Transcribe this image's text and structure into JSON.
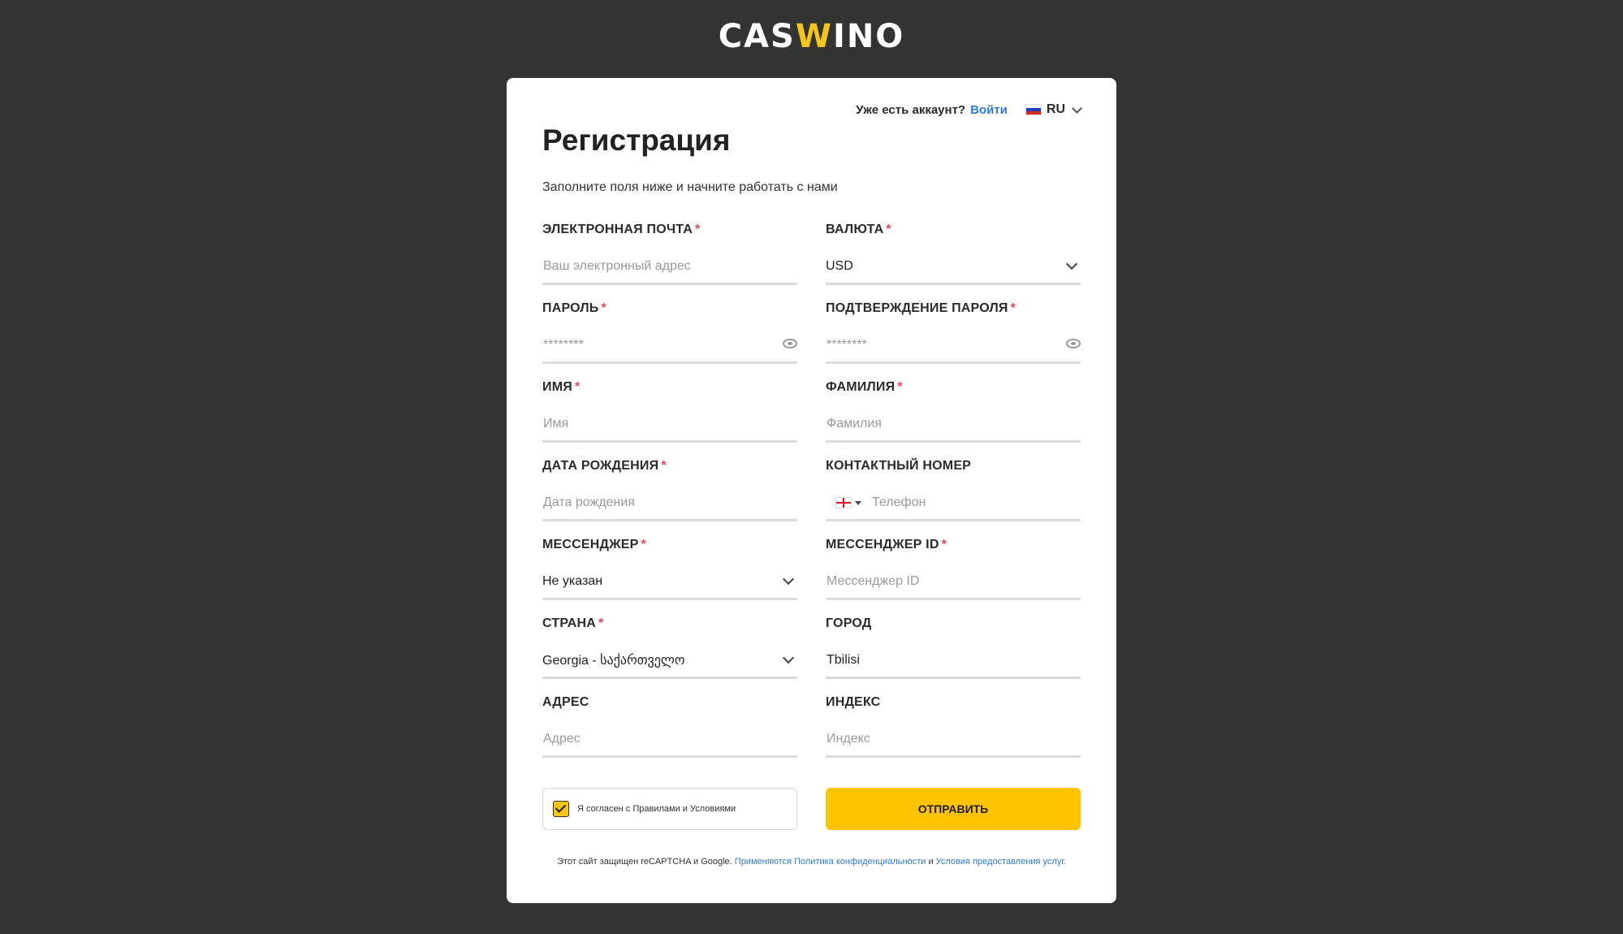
{
  "logo": {
    "part1": "CAS",
    "part2": "W",
    "part3": "INO"
  },
  "topbar": {
    "have_account": "Уже есть аккаунт?",
    "login": "Войти",
    "lang": "RU"
  },
  "title": "Регистрация",
  "subtitle": "Заполните поля ниже и начните работать с нами",
  "fields": {
    "email": {
      "label": "Электронная почта",
      "placeholder": "Ваш электронный адрес"
    },
    "currency": {
      "label": "Валюта",
      "value": "USD"
    },
    "password": {
      "label": "Пароль",
      "placeholder": "********"
    },
    "password_confirm": {
      "label": "Подтверждение пароля",
      "placeholder": "********"
    },
    "first_name": {
      "label": "Имя",
      "placeholder": "Имя"
    },
    "last_name": {
      "label": "Фамилия",
      "placeholder": "Фамилия"
    },
    "birth_date": {
      "label": "Дата рождения",
      "placeholder": "Дата рождения"
    },
    "phone": {
      "label": "Контактный номер",
      "placeholder": "Телефон"
    },
    "messenger": {
      "label": "Мессенджер",
      "value": "Не указан"
    },
    "messenger_id": {
      "label": "Мессенджер ID",
      "placeholder": "Мессенджер ID"
    },
    "country": {
      "label": "Страна",
      "value": "Georgia - საქართველო"
    },
    "city": {
      "label": "Город",
      "value": "Tbilisi"
    },
    "address": {
      "label": "Адрес",
      "placeholder": "Адрес"
    },
    "zip": {
      "label": "Индекс",
      "placeholder": "Индекс"
    },
    "required_mark": "*"
  },
  "agree": {
    "text": "Я согласен с Правилами и Условиями",
    "checked": true
  },
  "submit": "Отправить",
  "legal": {
    "text1": "Этот сайт защищен reCAPTCHA и Google.",
    "link1": "Применяются Политика конфиденциальности",
    "and": "и",
    "link2": "Условия предоставления услуг."
  },
  "colors": {
    "accent": "#ffc300",
    "link": "#2f7bd8",
    "background": "#323432",
    "required": "#e2495b"
  }
}
